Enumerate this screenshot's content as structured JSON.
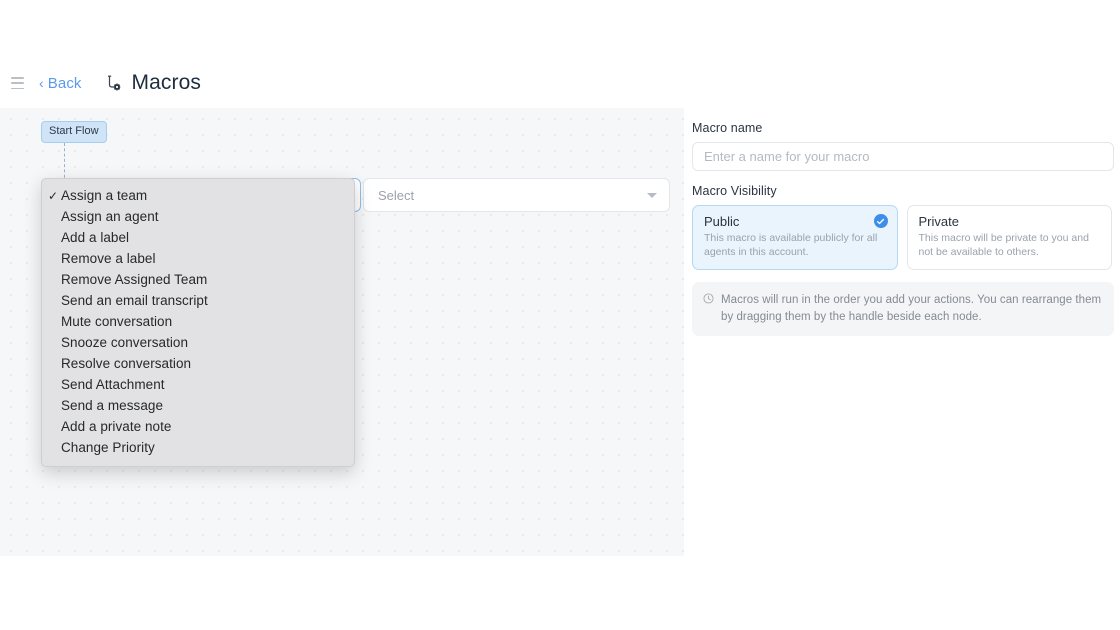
{
  "header": {
    "menu_icon": "hamburger-icon",
    "back_label": "Back",
    "back_chevron": "‹",
    "title_icon": "macro-wand-icon",
    "title": "Macros"
  },
  "canvas": {
    "start_flow_label": "Start Flow",
    "select_placeholder": "Select",
    "chevron_icon": "chevron-down-icon"
  },
  "dropdown": {
    "selected_index": 0,
    "check_glyph": "✓",
    "items": [
      "Assign a team",
      "Assign an agent",
      "Add a label",
      "Remove a label",
      "Remove Assigned Team",
      "Send an email transcript",
      "Mute conversation",
      "Snooze conversation",
      "Resolve conversation",
      "Send Attachment",
      "Send a message",
      "Add a private note",
      "Change Priority"
    ]
  },
  "panel": {
    "macro_name_label": "Macro name",
    "macro_name_value": "",
    "macro_name_placeholder": "Enter a name for your macro",
    "visibility_label": "Macro Visibility",
    "options": [
      {
        "title": "Public",
        "description": "This macro is available publicly for all agents in this account.",
        "selected": true
      },
      {
        "title": "Private",
        "description": "This macro will be private to you and not be available to others.",
        "selected": false
      }
    ],
    "info_icon": "info-circle-icon",
    "info_text": "Macros will run in the order you add your actions. You can rearrange them by dragging them by the handle beside each node."
  },
  "colors": {
    "accent": "#3c8ee8",
    "link": "#5c9bea",
    "canvas_bg": "#f6f7f9",
    "selected_card_bg": "#eaf4fc",
    "start_flow_bg": "#cfe4f7"
  }
}
